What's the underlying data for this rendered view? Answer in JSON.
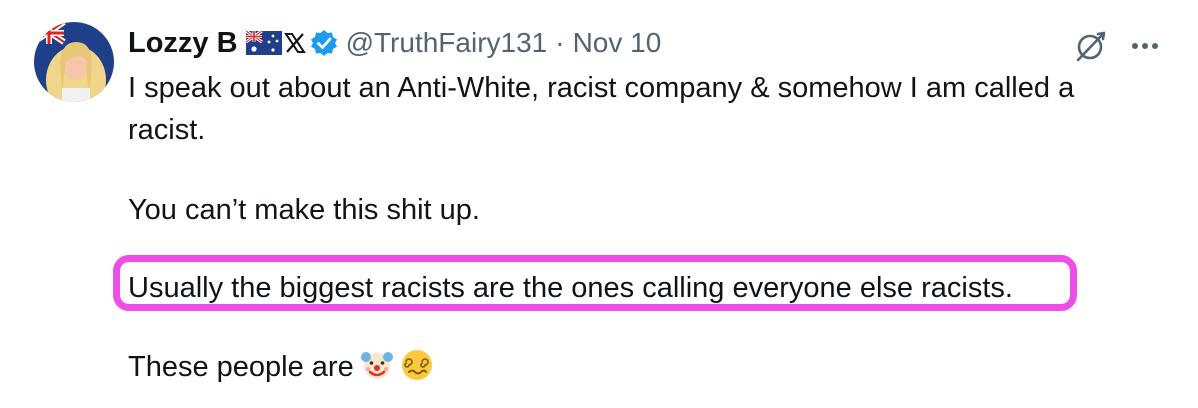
{
  "tweet": {
    "author": {
      "display_name": "Lozzy B",
      "handle": "@TruthFairy131",
      "flag_icon": "australian-flag-icon",
      "x_badge_icon": "x-logo-icon",
      "verified_icon": "verified-badge-icon"
    },
    "separator": "·",
    "date": "Nov 10",
    "actions": {
      "grok_icon": "grok-icon",
      "more_icon": "more-dots-icon"
    },
    "body_lines": [
      "I speak out about an Anti-White, racist company & somehow I am called a",
      "racist.",
      "You can’t make this shit up.",
      "Usually the biggest racists are the ones calling everyone else racists.",
      "These people are"
    ],
    "emojis": [
      "clown-face-emoji",
      "dizzy-face-emoji"
    ],
    "colors": {
      "highlight": "#ee4de8",
      "verified": "#1d9bf0",
      "secondary_text": "#536471",
      "primary_text": "#0f1419"
    }
  }
}
